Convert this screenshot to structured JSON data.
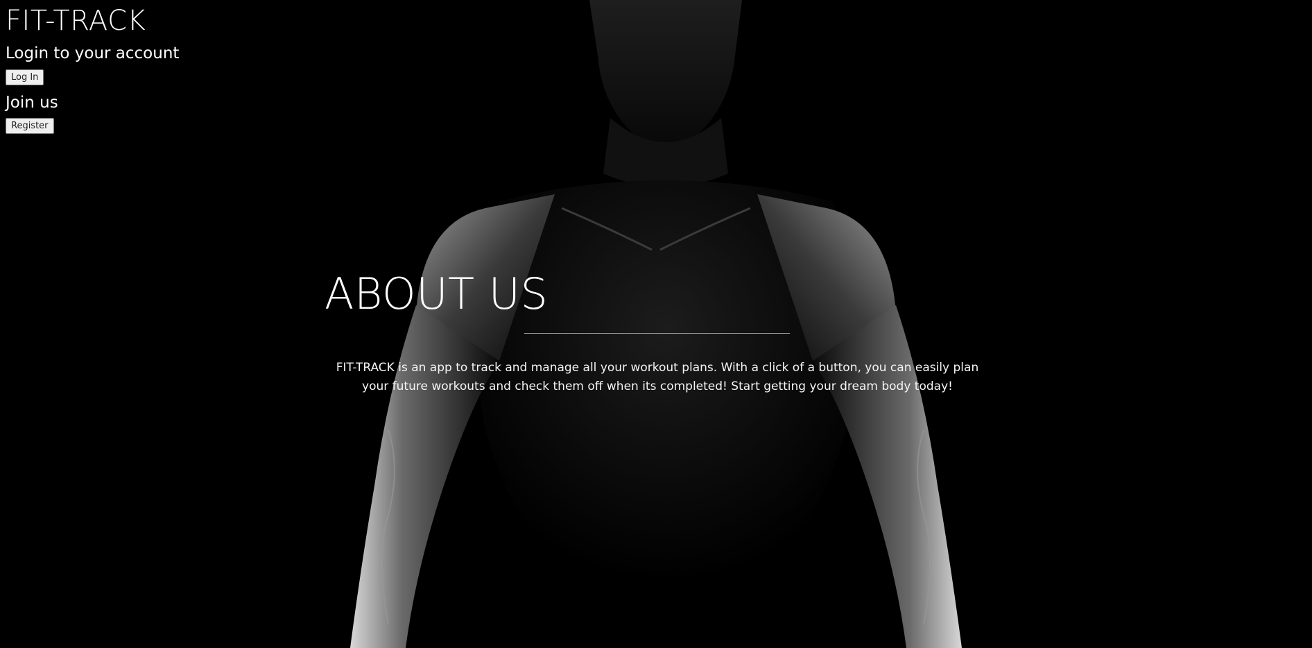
{
  "header": {
    "brand": "FIT-TRACK"
  },
  "login": {
    "heading": "Login to your account",
    "button_label": "Log In"
  },
  "register": {
    "heading": "Join us",
    "button_label": "Register"
  },
  "about": {
    "title": "ABOUT US",
    "text": "FIT-TRACK is an app to track and manage all your workout plans. With a click of a button, you can easily plan your future workouts and check them off when its completed! Start getting your dream body today!"
  },
  "colors": {
    "background": "#000000",
    "text": "#ffffff"
  }
}
